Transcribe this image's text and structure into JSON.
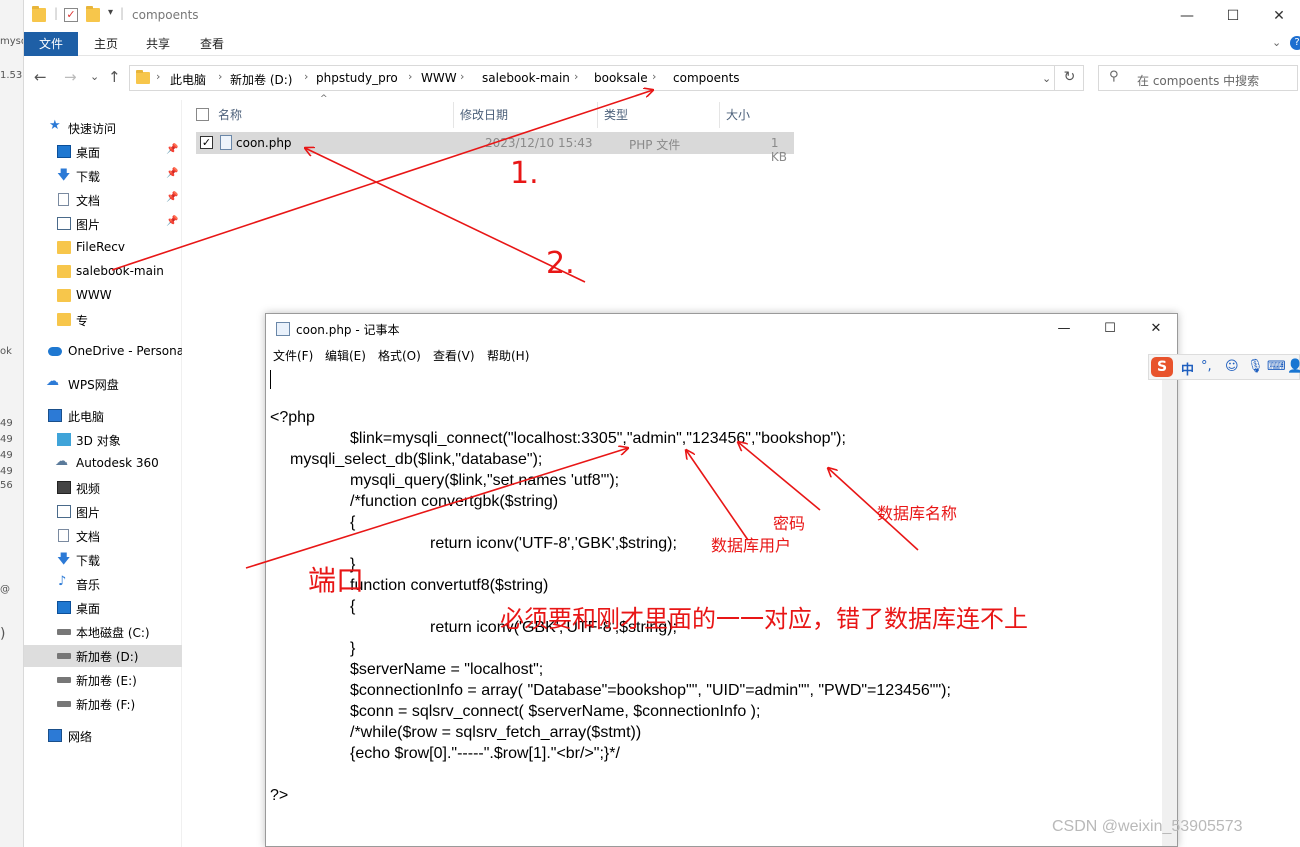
{
  "background_strip": {
    "fragments": [
      "mysql",
      "1.53",
      "ok",
      "49",
      "49",
      "49",
      "49",
      "56",
      "@",
      ")"
    ]
  },
  "explorer": {
    "title": "compoents",
    "window_controls": {
      "minimize": "—",
      "maximize": "☐",
      "close": "✕"
    },
    "ribbon_tabs": [
      "文件",
      "主页",
      "共享",
      "查看"
    ],
    "nav": {
      "back": "←",
      "forward": "→",
      "recent": "⌄",
      "up": "↑"
    },
    "address": {
      "crumbs": [
        "此电脑",
        "新加卷 (D:)",
        "phpstudy_pro",
        "WWW",
        "salebook-main",
        "booksale",
        "compoents"
      ],
      "separator": "›",
      "refresh": "↻"
    },
    "search": {
      "placeholder": "在 compoents 中搜索",
      "icon": "search-icon"
    },
    "sidebar": {
      "quick_access": "快速访问",
      "quick_items": [
        "桌面",
        "下载",
        "文档",
        "图片",
        "FileRecv",
        "salebook-main",
        "WWW",
        "专"
      ],
      "onedrive": "OneDrive - Persona",
      "wps": "WPS网盘",
      "this_pc": "此电脑",
      "pc_items": [
        "3D 对象",
        "Autodesk 360",
        "视频",
        "图片",
        "文档",
        "下载",
        "音乐",
        "桌面",
        "本地磁盘 (C:)",
        "新加卷 (D:)",
        "新加卷 (E:)",
        "新加卷 (F:)"
      ],
      "network": "网络"
    },
    "columns": [
      "名称",
      "修改日期",
      "类型",
      "大小"
    ],
    "files": [
      {
        "name": "coon.php",
        "modified": "2023/12/10 15:43",
        "type": "PHP 文件",
        "size": "1 KB",
        "checked": true
      }
    ]
  },
  "notepad": {
    "title": "coon.php - 记事本",
    "menu": [
      "文件(F)",
      "编辑(E)",
      "格式(O)",
      "查看(V)",
      "帮助(H)"
    ],
    "window_controls": {
      "minimize": "—",
      "maximize": "☐",
      "close": "✕"
    },
    "code_lines": [
      "<?php",
      "$link=mysqli_connect(\"localhost:3305\",\"admin\",\"123456\",\"bookshop\");",
      "mysqli_select_db($link,\"database\");",
      "mysqli_query($link,\"set names 'utf8'\");",
      "/*function convertgbk($string)",
      "{",
      "return iconv('UTF-8','GBK',$string);",
      "}",
      "function convertutf8($string)",
      "{",
      "return iconv('GBK','UTF-8',$string);",
      "}",
      "$serverName = \"localhost\";",
      "$connectionInfo = array( \"Database\"=bookshop\"\", \"UID\"=admin\"\", \"PWD\"=123456\"\");",
      "$conn = sqlsrv_connect( $serverName, $connectionInfo );",
      "/*while($row = sqlsrv_fetch_array($stmt))",
      "{echo $row[0].\"-----\".$row[1].\"<br/>\";}*/",
      "?>"
    ]
  },
  "ime_toolbar": {
    "logo": "S",
    "mode": "中",
    "punct": "°,",
    "items": [
      "☺",
      "🎙",
      "⌨",
      "👤"
    ]
  },
  "annotations": {
    "step1": "1.",
    "step2": "2.",
    "port": "端口",
    "password": "密码",
    "db_user": "数据库用户",
    "db_name": "数据库名称",
    "note": "必须要和刚才里面的一一对应，错了数据库连不上",
    "color": "#e81616"
  },
  "watermark": "CSDN @weixin_53905573"
}
